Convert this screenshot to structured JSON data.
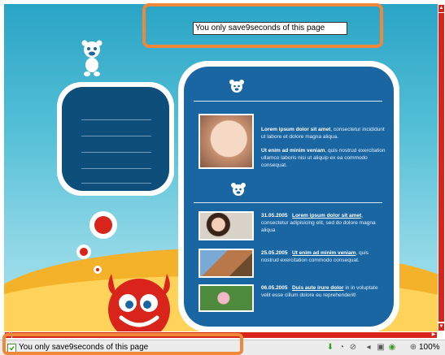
{
  "page": {
    "title_field": "You only save9seconds of this page"
  },
  "feature": {
    "para1_bold": "Lorem ipsum dolor sit amet",
    "para1_rest": ", consectetur incididunt ut labore et dolore magna aliqua.",
    "para2_bold": "Ut enim ad minim veniam",
    "para2_rest": ", quis nostrud exercitation ullamco laboris nisi ut aliquip ex ea commodo consequat."
  },
  "news": [
    {
      "date": "31.05.2005",
      "link": "Lorem ipsum dolor sit amet",
      "text": ", consectetur adipisicing elit, sed do dolore magna aliqua"
    },
    {
      "date": "25.05.2005",
      "link": "Ut enim ad minim veniam",
      "text": ", quis nostrud exercitation commodo consequat."
    },
    {
      "date": "06.05.2005",
      "link": "Duis aute irure dolor",
      "text": " in in voluptate velit esse cillum dolore eu reprehenderit!"
    }
  ],
  "statusbar": {
    "text": "You only save9seconds of this page",
    "zoom": "100%"
  },
  "icons": {
    "status_page": "page-icon",
    "download": "download-arrow-icon",
    "zoom": "zoom-icon"
  },
  "colors": {
    "highlight": "#f0883a",
    "scrollbar": "#d8241a",
    "panel": "#1a66a3"
  }
}
